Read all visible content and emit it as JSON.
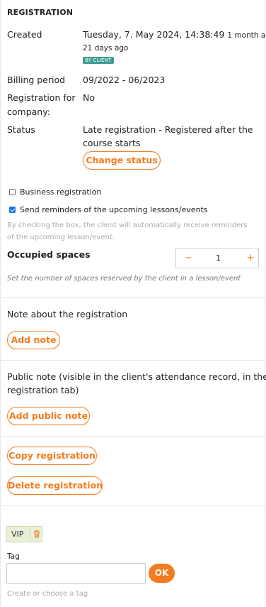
{
  "section_title": "REGISTRATION",
  "details": {
    "created_label": "Created",
    "created_value": "Tuesday, 7. May 2024, 14:38:49",
    "created_relative_a": "1 month and",
    "created_relative_b": "21 days ago",
    "created_badge": "BY CLIENT",
    "billing_label": "Billing period",
    "billing_value": "09/2022 - 06/2023",
    "company_label_a": "Registration for",
    "company_label_b": "company:",
    "company_value": "No",
    "status_label": "Status",
    "status_value_a": "Late registration - Registered after the",
    "status_value_b": "course starts",
    "change_status_label": "Change status"
  },
  "options": {
    "business_label": "Business registration",
    "business_checked": false,
    "reminders_label": "Send reminders of the upcoming lessons/events",
    "reminders_checked": true,
    "reminders_hint_a": "By checking the box, the client will automatically receive reminders",
    "reminders_hint_b": "of the upcoming lesson/event."
  },
  "occupied": {
    "label": "Occupied spaces",
    "value": "1",
    "minus": "−",
    "plus": "+",
    "hint": "Set the number of spaces reserved by the client in a lesson/event"
  },
  "note": {
    "label": "Note about the registration",
    "button": "Add note"
  },
  "public_note": {
    "label_a": "Public note (visible in the client's attendance record, in the",
    "label_b": "registration tab)",
    "button": "Add public note"
  },
  "actions": {
    "copy": "Copy registration",
    "delete": "Delete registration"
  },
  "tags": {
    "items": [
      "VIP"
    ],
    "field_label": "Tag",
    "input_value": "",
    "ok": "OK",
    "hint": "Create or choose a tag"
  },
  "colors": {
    "accent": "#f47c20",
    "badge": "#3f9c93",
    "checkbox": "#1a73e8",
    "tag_bg": "#e9f0d8"
  }
}
